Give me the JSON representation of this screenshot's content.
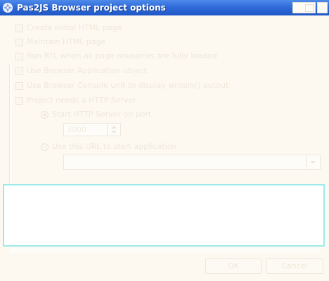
{
  "window": {
    "title": "Pas2JS Browser project options",
    "icon": "lazarus-app-icon"
  },
  "options": {
    "create_html_page": "Create initial HTML page",
    "maintain_html_page": "Maintain HTML page",
    "run_init_on_page_load": "Run RTL when all page resources are fully loaded",
    "use_browser_application_object": "Use Browser Application object",
    "use_browser_console": "Use Browser Console unit to display writeln() output",
    "project_needs_http_server": "Project needs a HTTP Server",
    "start_http_server_on_port": "Start HTTP Server on port",
    "use_this_url": "Use this URL to start application"
  },
  "port": {
    "value": "3000"
  },
  "url": {
    "value": ""
  },
  "buttons": {
    "ok": "OK",
    "cancel": "Cancel"
  },
  "colors": {
    "titlebar": "#2f6bd9",
    "background": "#fdf9f1",
    "memo_border": "#9eeaea"
  }
}
